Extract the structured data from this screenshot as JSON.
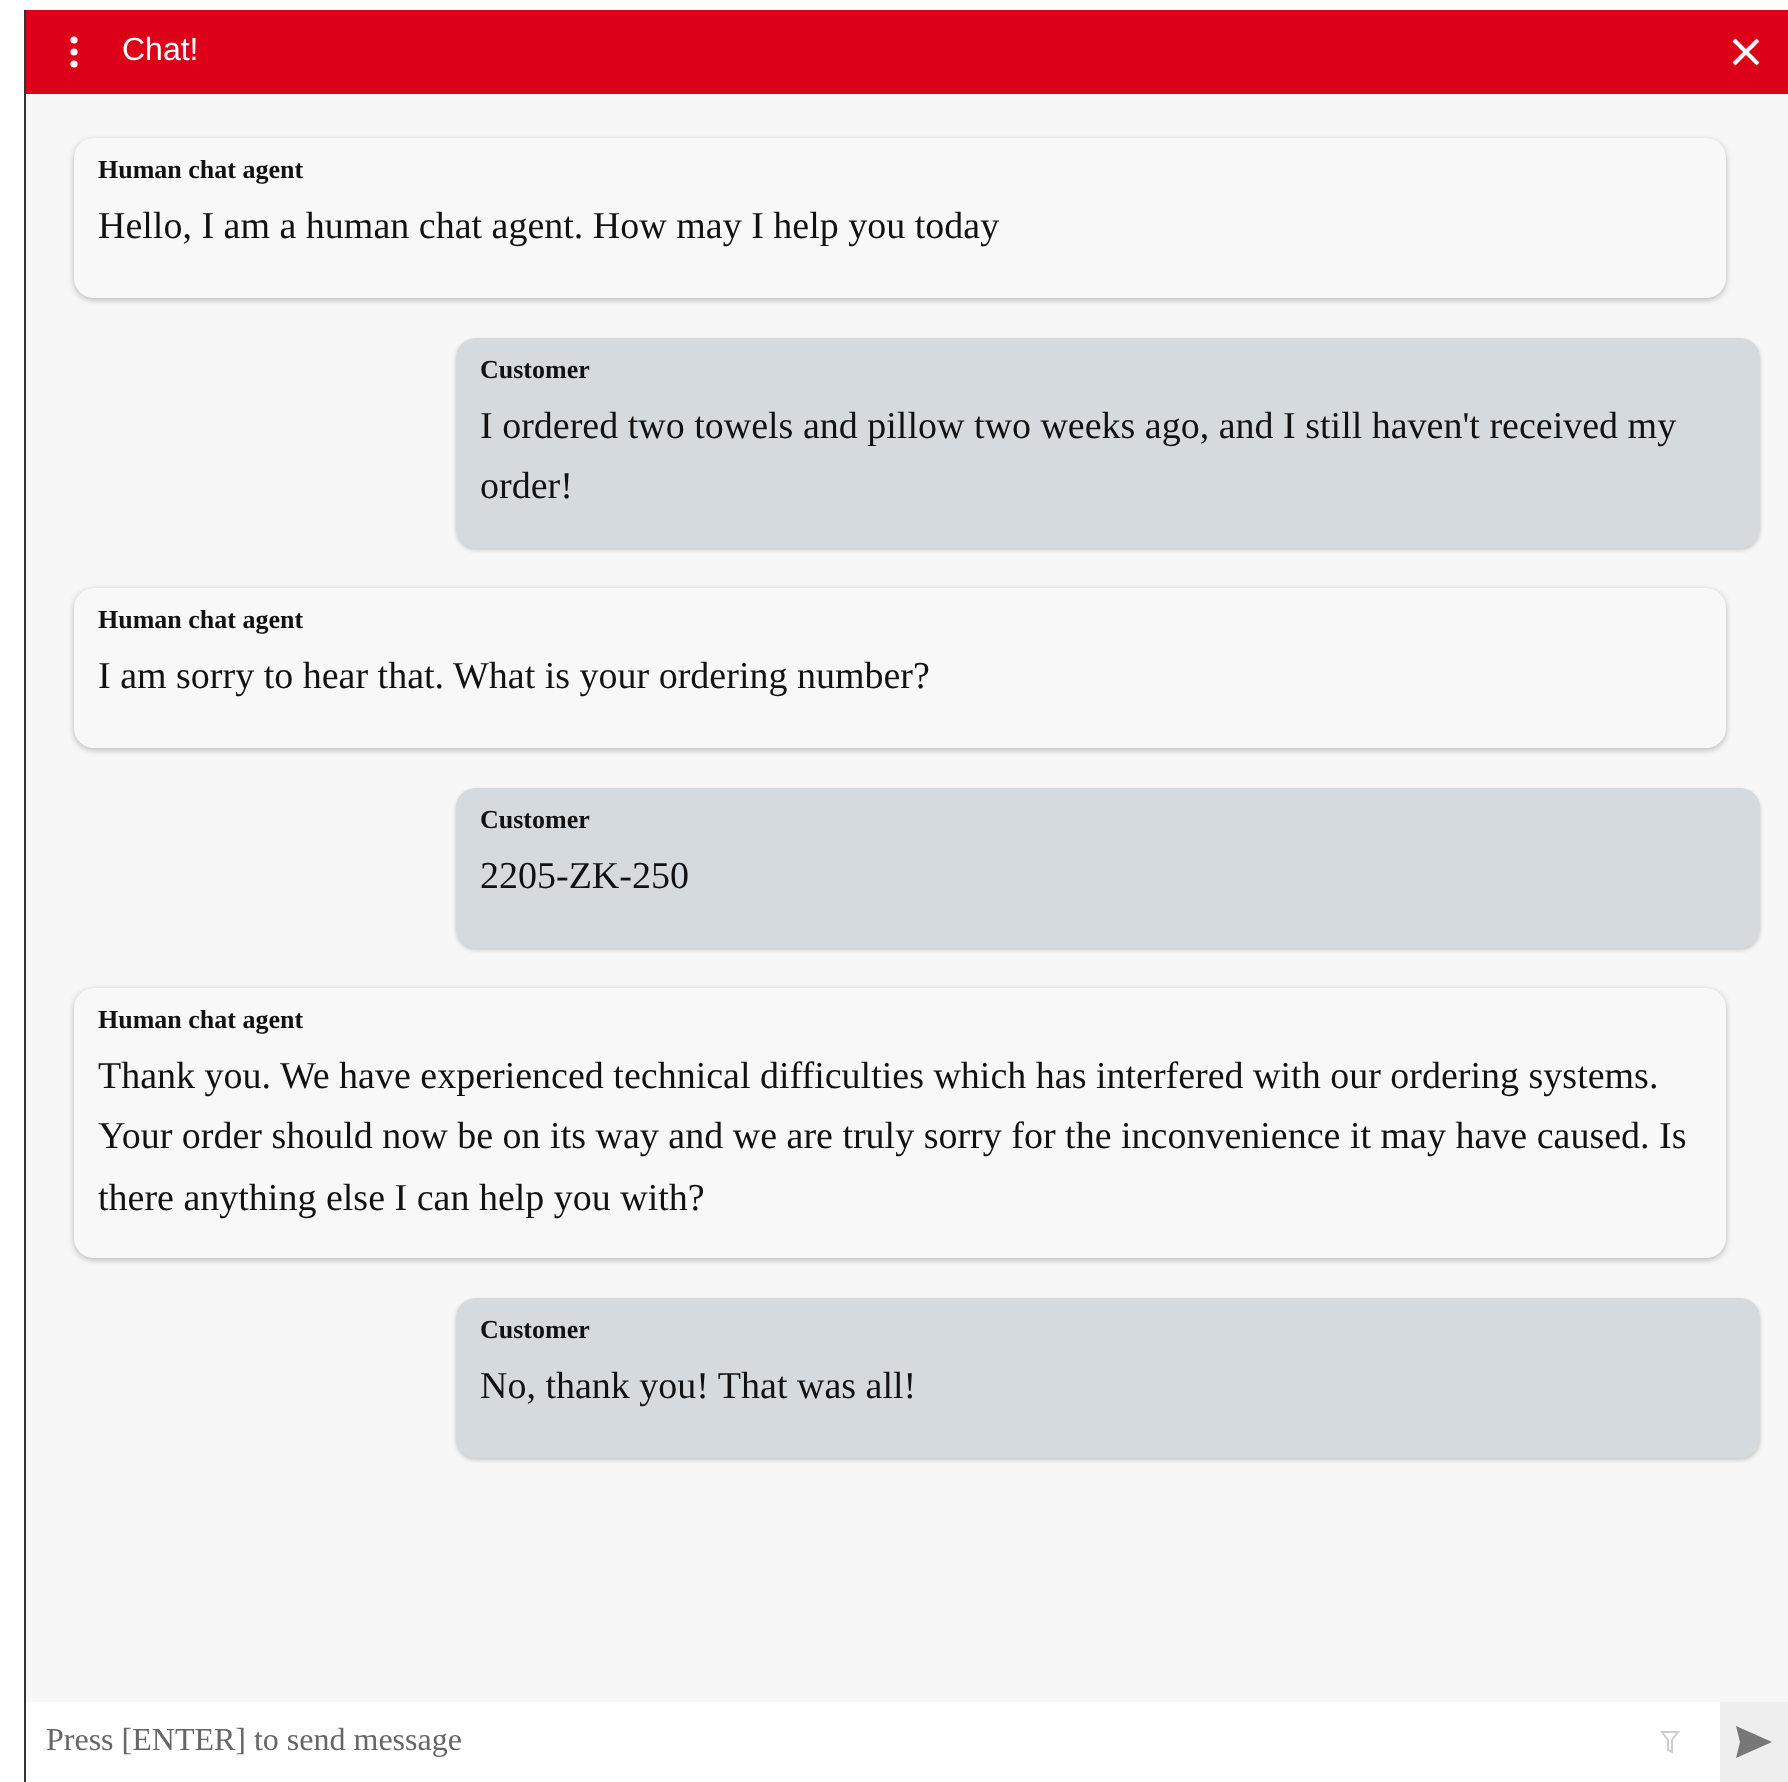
{
  "window": {
    "title": "Chat!"
  },
  "messages": [
    {
      "kind": "agent",
      "sender": "Human chat agent",
      "text": "Hello, I am a human chat agent. How may I help you today"
    },
    {
      "kind": "customer",
      "sender": "Customer",
      "text": "I ordered two towels and pillow two weeks ago, and I still haven't received my order!"
    },
    {
      "kind": "agent",
      "sender": "Human chat agent",
      "text": "I am sorry to hear that. What is your ordering number?"
    },
    {
      "kind": "customer",
      "sender": "Customer",
      "text": "2205-ZK-250"
    },
    {
      "kind": "agent",
      "sender": "Human chat agent",
      "text": "Thank you. We have experienced technical difficulties which has interfered with our ordering systems. Your order should now be on its way and we are truly sorry for the inconvenience it may have caused. Is there anything else I can help you with?"
    },
    {
      "kind": "customer",
      "sender": "Customer",
      "text": "No, thank you! That was all!"
    }
  ],
  "composer": {
    "placeholder": "Press [ENTER] to send message"
  }
}
